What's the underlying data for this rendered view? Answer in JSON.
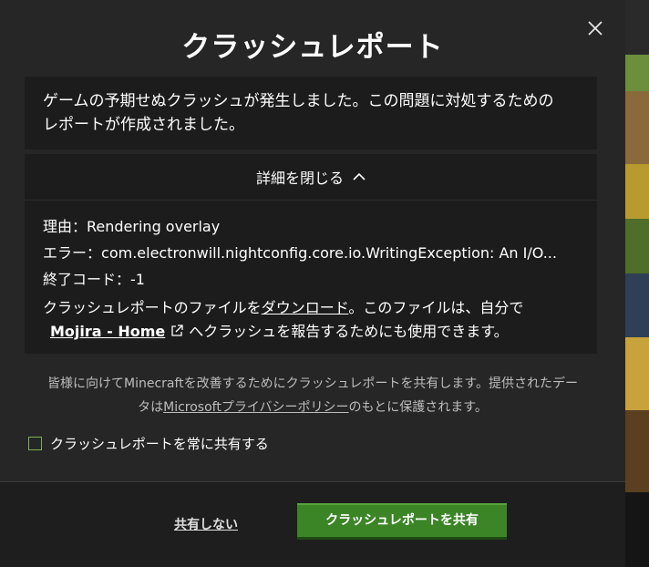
{
  "dialog": {
    "title": "クラッシュレポート",
    "close_icon": "close-icon"
  },
  "message": {
    "text_line1": "ゲームの予期せぬクラッシュが発生しました。この問題に対処するための",
    "text_line2": "レポートが作成されました。"
  },
  "details": {
    "toggle_label": "詳細を閉じる",
    "toggle_icon": "chevron-up-icon",
    "reason_label": "理由：",
    "reason_value": "Rendering overlay",
    "error_label": "エラー：",
    "error_value": "com.electronwill.nightconfig.core.io.WritingException: An I/O...",
    "exit_code_label": "終了コード：",
    "exit_code_value": "-1",
    "file_text_before": "クラッシュレポートのファイルを",
    "file_link": "ダウンロード",
    "file_text_after": "。このファイルは、自分で",
    "mojira_link": "Mojira - Home",
    "mojira_icon": "external-link-icon",
    "mojira_text_after": "へクラッシュを報告するためにも使用できます。"
  },
  "privacy": {
    "line1": "皆様に向けてMinecraftを改善するためにクラッシュレポートを共有します。提供されたデー",
    "line2_prefix": "タは",
    "link": "Microsoftプライバシーポリシー",
    "line2_suffix": "のもとに保護されます。"
  },
  "checkbox": {
    "label": "クラッシュレポートを常に共有する",
    "checked": false
  },
  "footer": {
    "decline_label": "共有しない",
    "share_label": "クラッシュレポートを共有"
  },
  "colors": {
    "accent_green": "#3c8527",
    "dialog_bg": "#262626",
    "panel_bg": "#1c1c1c"
  }
}
